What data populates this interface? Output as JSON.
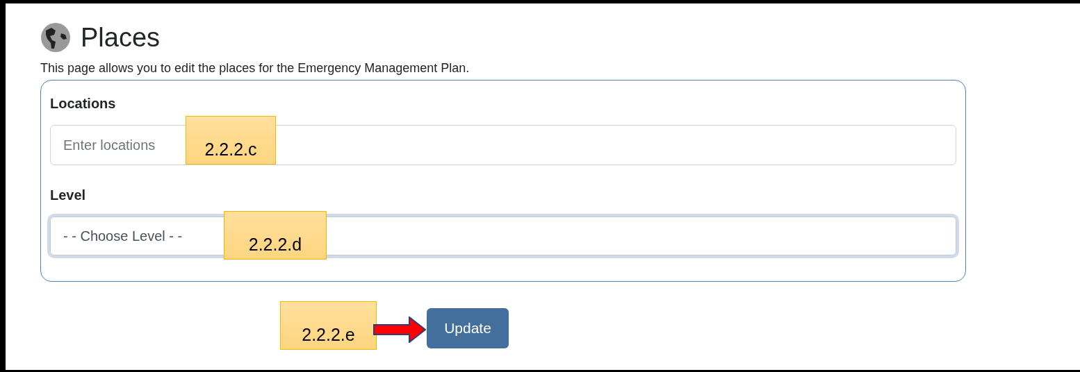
{
  "page": {
    "title": "Places",
    "description": "This page allows you to edit the places for the Emergency Management Plan."
  },
  "form": {
    "fields": [
      {
        "kind": "text",
        "label": "Locations",
        "placeholder": "Enter locations",
        "focused": false
      },
      {
        "kind": "select",
        "label": "Level",
        "value": "- - Choose Level - -",
        "focused": true
      }
    ]
  },
  "button": {
    "label": "Update"
  },
  "annotations": [
    {
      "label": "2.2.2.c",
      "arrow": false
    },
    {
      "label": "2.2.2.d",
      "arrow": false
    },
    {
      "label": "2.2.2.e",
      "arrow": true
    }
  ]
}
